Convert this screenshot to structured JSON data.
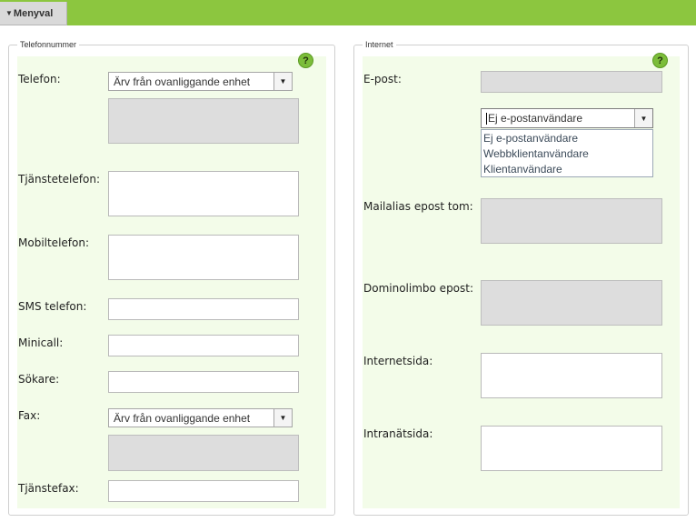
{
  "topbar": {
    "menu_label": "Menyval"
  },
  "phone_panel": {
    "legend": "Telefonnummer",
    "telefon_label": "Telefon:",
    "telefon_select": "Ärv från ovanliggande enhet",
    "tjanstetelefon_label": "Tjänstetelefon:",
    "mobiltelefon_label": "Mobiltelefon:",
    "sms_label": "SMS telefon:",
    "minicall_label": "Minicall:",
    "sokare_label": "Sökare:",
    "fax_label": "Fax:",
    "fax_select": "Ärv från ovanliggande enhet",
    "tjanstefax_label": "Tjänstefax:"
  },
  "internet_panel": {
    "legend": "Internet",
    "epost_label": "E-post:",
    "user_type_select": "Ej e-postanvändare",
    "user_type_options": [
      "Ej e-postanvändare",
      "Webbklientanvändare",
      "Klientanvändare"
    ],
    "mailalias_label": "Mailalias epost tom:",
    "dominolimbo_label": "Dominolimbo epost:",
    "internetsida_label": "Internetsida:",
    "intranatsida_label": "Intranätsida:"
  },
  "help_symbol": "?"
}
